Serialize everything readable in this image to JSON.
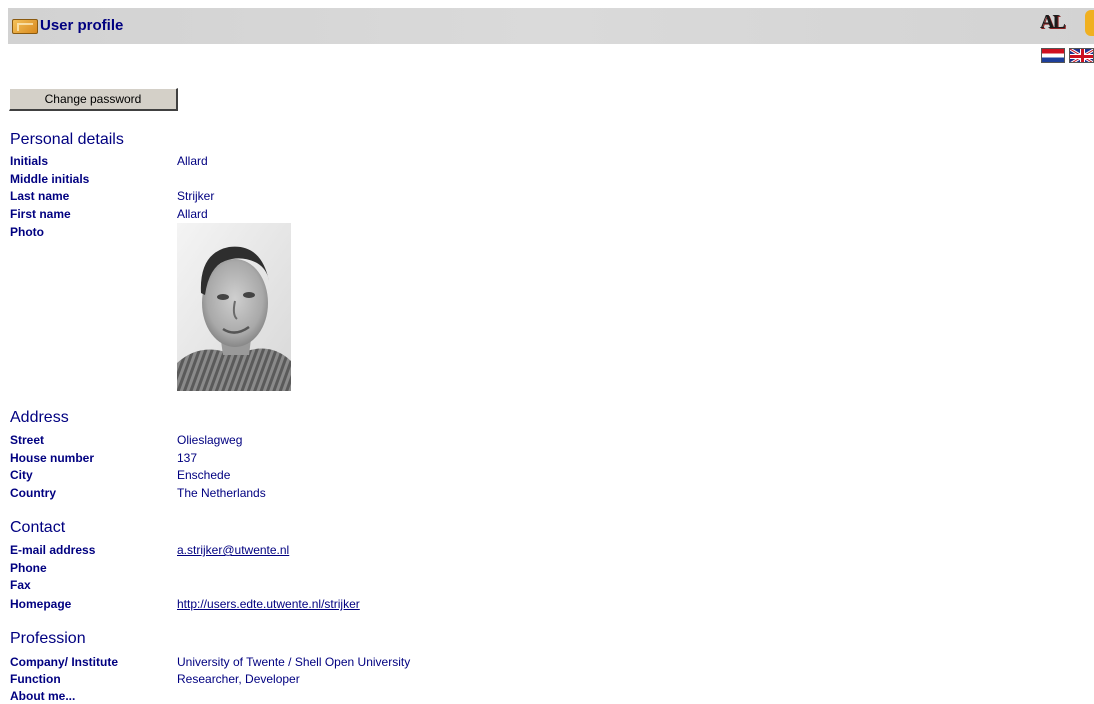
{
  "header": {
    "title": "User profile",
    "logo_text": "AL"
  },
  "actions": {
    "change_password": "Change password"
  },
  "personal": {
    "title": "Personal details",
    "initials_label": "Initials",
    "initials": "Allard",
    "middle_label": "Middle initials",
    "middle": "",
    "last_label": "Last name",
    "last": "Strijker",
    "first_label": "First name",
    "first": "Allard",
    "photo_label": "Photo"
  },
  "address": {
    "title": "Address",
    "street_label": "Street",
    "street": "Olieslagweg",
    "number_label": "House number",
    "number": "137",
    "city_label": "City",
    "city": "Enschede",
    "country_label": "Country",
    "country": "The Netherlands"
  },
  "contact": {
    "title": "Contact",
    "email_label": "E-mail address",
    "email": "a.strijker@utwente.nl",
    "phone_label": "Phone",
    "phone": "",
    "fax_label": "Fax",
    "fax": "",
    "homepage_label": "Homepage",
    "homepage": "http://users.edte.utwente.nl/strijker"
  },
  "profession": {
    "title": "Profession",
    "company_label": "Company/ Institute",
    "company": "University of Twente / Shell Open University",
    "function_label": "Function",
    "function": "Researcher, Developer",
    "about_label": "About me..."
  },
  "colors": {
    "text": "#000080",
    "header_bg": "#d4d4d4",
    "button_bg": "#d4d0c8"
  },
  "icons": [
    "folder-picture-icon",
    "al-logo-icon",
    "flag-nl-icon",
    "flag-uk-icon"
  ]
}
